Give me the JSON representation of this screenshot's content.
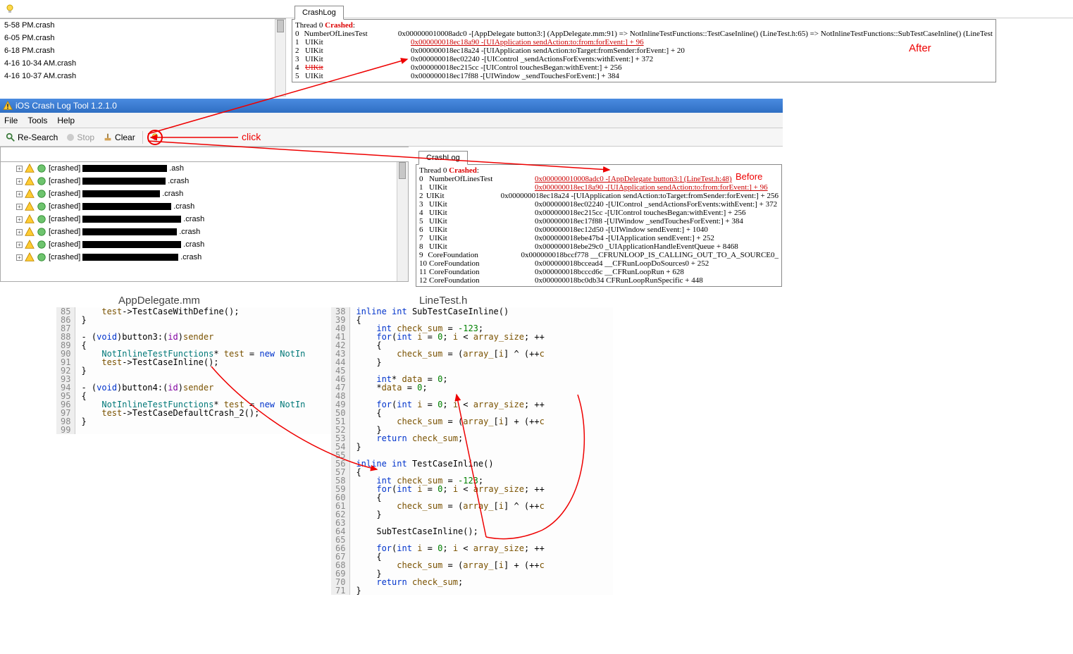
{
  "topFiles": [
    "5-58 PM.crash",
    "6-05 PM.crash",
    "6-18 PM.crash",
    "4-16 10-34 AM.crash",
    "4-16 10-37 AM.crash"
  ],
  "afterTab": "CrashLog",
  "threadHeader": {
    "prefix": "Thread 0 ",
    "word": "Crashed",
    "suffix": ":"
  },
  "afterRows": [
    {
      "i": "0",
      "mod": "NumberOfLinesTest",
      "addr": "0x000000010008adc0 -[AppDelegate button3:] (AppDelegate.mm:91) => NotInlineTestFunctions::TestCaseInline() (LineTest.h:65) => NotInlineTestFunctions::SubTestCaseInline() (LineTest"
    },
    {
      "i": "1",
      "mod": "UIKit",
      "addr": "0x000000018ec18a90 -[UIApplication sendAction:to:from:forEvent:] + 96",
      "under": true
    },
    {
      "i": "2",
      "mod": "UIKit",
      "addr": "0x000000018ec18a24 -[UIApplication sendAction:toTarget:fromSender:forEvent:] + 20"
    },
    {
      "i": "3",
      "mod": "UIKit",
      "addr": "0x000000018ec02240 -[UIControl _sendActionsForEvents:withEvent:] + 372"
    },
    {
      "i": "4",
      "mod": "UIKit",
      "addr": "0x000000018ec215cc -[UIControl touchesBegan:withEvent:] + 256",
      "struck": true
    },
    {
      "i": "5",
      "mod": "UIKit",
      "addr": "0x000000018ec17f88 -[UIWindow _sendTouchesForEvent:] + 384"
    }
  ],
  "beforeRows": [
    {
      "i": "0",
      "mod": "NumberOfLinesTest",
      "addr": "0x000000010008adc0 -[AppDelegate button3:] (LineTest.h:48)",
      "under": true
    },
    {
      "i": "1",
      "mod": "UIKit",
      "addr": "0x000000018ec18a90 -[UIApplication sendAction:to:from:forEvent:] + 96",
      "under": true
    },
    {
      "i": "2",
      "mod": "UIKit",
      "addr": "0x000000018ec18a24 -[UIApplication sendAction:toTarget:fromSender:forEvent:] + 256"
    },
    {
      "i": "3",
      "mod": "UIKit",
      "addr": "0x000000018ec02240 -[UIControl _sendActionsForEvents:withEvent:] + 372"
    },
    {
      "i": "4",
      "mod": "UIKit",
      "addr": "0x000000018ec215cc -[UIControl touchesBegan:withEvent:] + 256"
    },
    {
      "i": "5",
      "mod": "UIKit",
      "addr": "0x000000018ec17f88 -[UIWindow _sendTouchesForEvent:] + 384"
    },
    {
      "i": "6",
      "mod": "UIKit",
      "addr": "0x000000018ec12d50 -[UIWindow sendEvent:] + 1040"
    },
    {
      "i": "7",
      "mod": "UIKit",
      "addr": "0x000000018ebe47b4 -[UIApplication sendEvent:] + 252"
    },
    {
      "i": "8",
      "mod": "UIKit",
      "addr": "0x000000018ebe29c0 _UIApplicationHandleEventQueue + 8468"
    },
    {
      "i": "9",
      "mod": "CoreFoundation",
      "addr": "0x000000018bccf778 __CFRUNLOOP_IS_CALLING_OUT_TO_A_SOURCE0_"
    },
    {
      "i": "10",
      "mod": "CoreFoundation",
      "addr": "0x000000018bccead4 __CFRunLoopDoSources0 + 252"
    },
    {
      "i": "11",
      "mod": "CoreFoundation",
      "addr": "0x000000018bcccd6c __CFRunLoopRun + 628"
    },
    {
      "i": "12",
      "mod": "CoreFoundation",
      "addr": "0x000000018bc0db34 CFRunLoopRunSpecific + 448"
    }
  ],
  "windowTitle": "iOS Crash Log Tool 1.2.1.0",
  "menus": [
    "File",
    "Tools",
    "Help"
  ],
  "toolbar": {
    "research": "Re-Search",
    "stop": "Stop",
    "clear": "Clear"
  },
  "crashedLabel": "[crashed]",
  "treeItems": [
    {
      "pre": 120,
      "suf": ".ash"
    },
    {
      "pre": 118,
      "suf": ".crash"
    },
    {
      "pre": 110,
      "suf": ".crash"
    },
    {
      "pre": 126,
      "suf": ".crash"
    },
    {
      "pre": 140,
      "suf": ".crash"
    },
    {
      "pre": 134,
      "suf": ".crash"
    },
    {
      "pre": 140,
      "suf": ".crash"
    },
    {
      "pre": 136,
      "suf": ".crash"
    }
  ],
  "annot": {
    "after": "After",
    "before": "Before",
    "click": "click"
  },
  "codeA": {
    "title": "AppDelegate.mm",
    "start": 85,
    "highlight": 91,
    "lines": [
      "    test->TestCaseWithDefine();",
      "}",
      "",
      "- (void)button3:(id)sender",
      "{",
      "    NotInlineTestFunctions* test = new NotIn",
      "    test->TestCaseInline();",
      "}",
      "",
      "- (void)button4:(id)sender",
      "{",
      "    NotInlineTestFunctions* test = new NotIn",
      "    test->TestCaseDefaultCrash_2();",
      "}",
      ""
    ]
  },
  "codeB": {
    "title": "LineTest.h",
    "start": 38,
    "highlight": 48,
    "lines": [
      "inline int SubTestCaseInline()",
      "{",
      "    int check_sum = -123;",
      "    for(int i = 0; i < array_size; ++",
      "    {",
      "        check_sum = (array_[i] ^ (++c",
      "    }",
      "",
      "    int* data = 0;",
      "    *data = 0;",
      "",
      "    for(int i = 0; i < array_size; ++",
      "    {",
      "        check_sum = (array_[i] + (++c",
      "    }",
      "    return check_sum;",
      "}",
      "",
      "inline int TestCaseInline()",
      "{",
      "    int check_sum = -123;",
      "    for(int i = 0; i < array_size; ++",
      "    {",
      "        check_sum = (array_[i] ^ (++c",
      "    }",
      "",
      "    SubTestCaseInline();",
      "",
      "    for(int i = 0; i < array_size; ++",
      "    {",
      "        check_sum = (array_[i] + (++c",
      "    }",
      "    return check_sum;",
      "}"
    ]
  }
}
